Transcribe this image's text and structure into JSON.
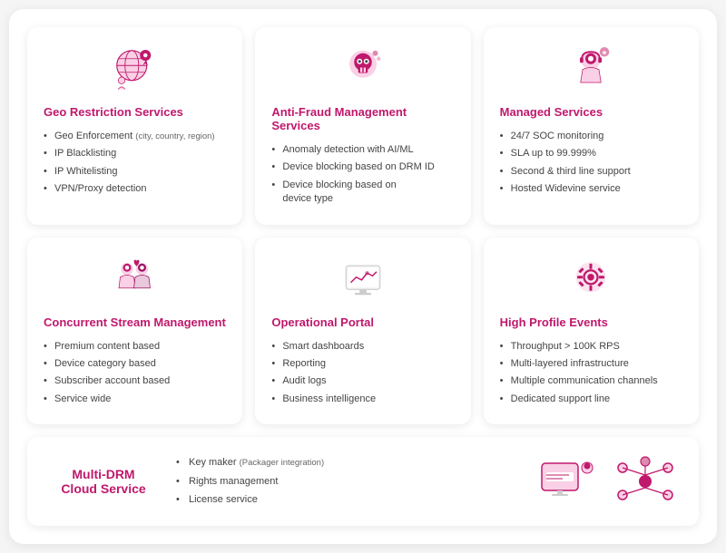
{
  "cards": [
    {
      "id": "geo-restriction",
      "title": "Geo Restriction Services",
      "items": [
        {
          "text": "Geo Enforcement",
          "suffix": " (city, country, region)"
        },
        {
          "text": "IP Blacklisting"
        },
        {
          "text": "IP Whitelisting"
        },
        {
          "text": "VPN/Proxy detection"
        }
      ]
    },
    {
      "id": "anti-fraud",
      "title": "Anti-Fraud Management Services",
      "items": [
        {
          "text": "Anomaly detection with AI/ML"
        },
        {
          "text": "Device blocking based on DRM ID"
        },
        {
          "text": "Device blocking based on device type"
        }
      ]
    },
    {
      "id": "managed-services",
      "title": "Managed Services",
      "items": [
        {
          "text": "24/7 SOC monitoring"
        },
        {
          "text": "SLA up to 99.999%"
        },
        {
          "text": "Second & third line support"
        },
        {
          "text": "Hosted Widevine service"
        }
      ]
    },
    {
      "id": "concurrent-stream",
      "title": "Concurrent Stream Management",
      "items": [
        {
          "text": "Premium content based"
        },
        {
          "text": "Device category based"
        },
        {
          "text": "Subscriber account based"
        },
        {
          "text": "Service wide"
        }
      ]
    },
    {
      "id": "operational-portal",
      "title": "Operational Portal",
      "items": [
        {
          "text": "Smart dashboards"
        },
        {
          "text": "Reporting"
        },
        {
          "text": "Audit logs"
        },
        {
          "text": "Business intelligence"
        }
      ]
    },
    {
      "id": "high-profile",
      "title": "High Profile Events",
      "items": [
        {
          "text": "Throughput > 100K RPS"
        },
        {
          "text": "Multi-layered infrastructure"
        },
        {
          "text": "Multiple communication channels"
        },
        {
          "text": "Dedicated support line"
        }
      ]
    }
  ],
  "bottom": {
    "title": "Multi-DRM\nCloud Service",
    "items": [
      {
        "text": "Key maker",
        "suffix": " (Packager integration)"
      },
      {
        "text": "Rights management"
      },
      {
        "text": "License service"
      }
    ]
  }
}
